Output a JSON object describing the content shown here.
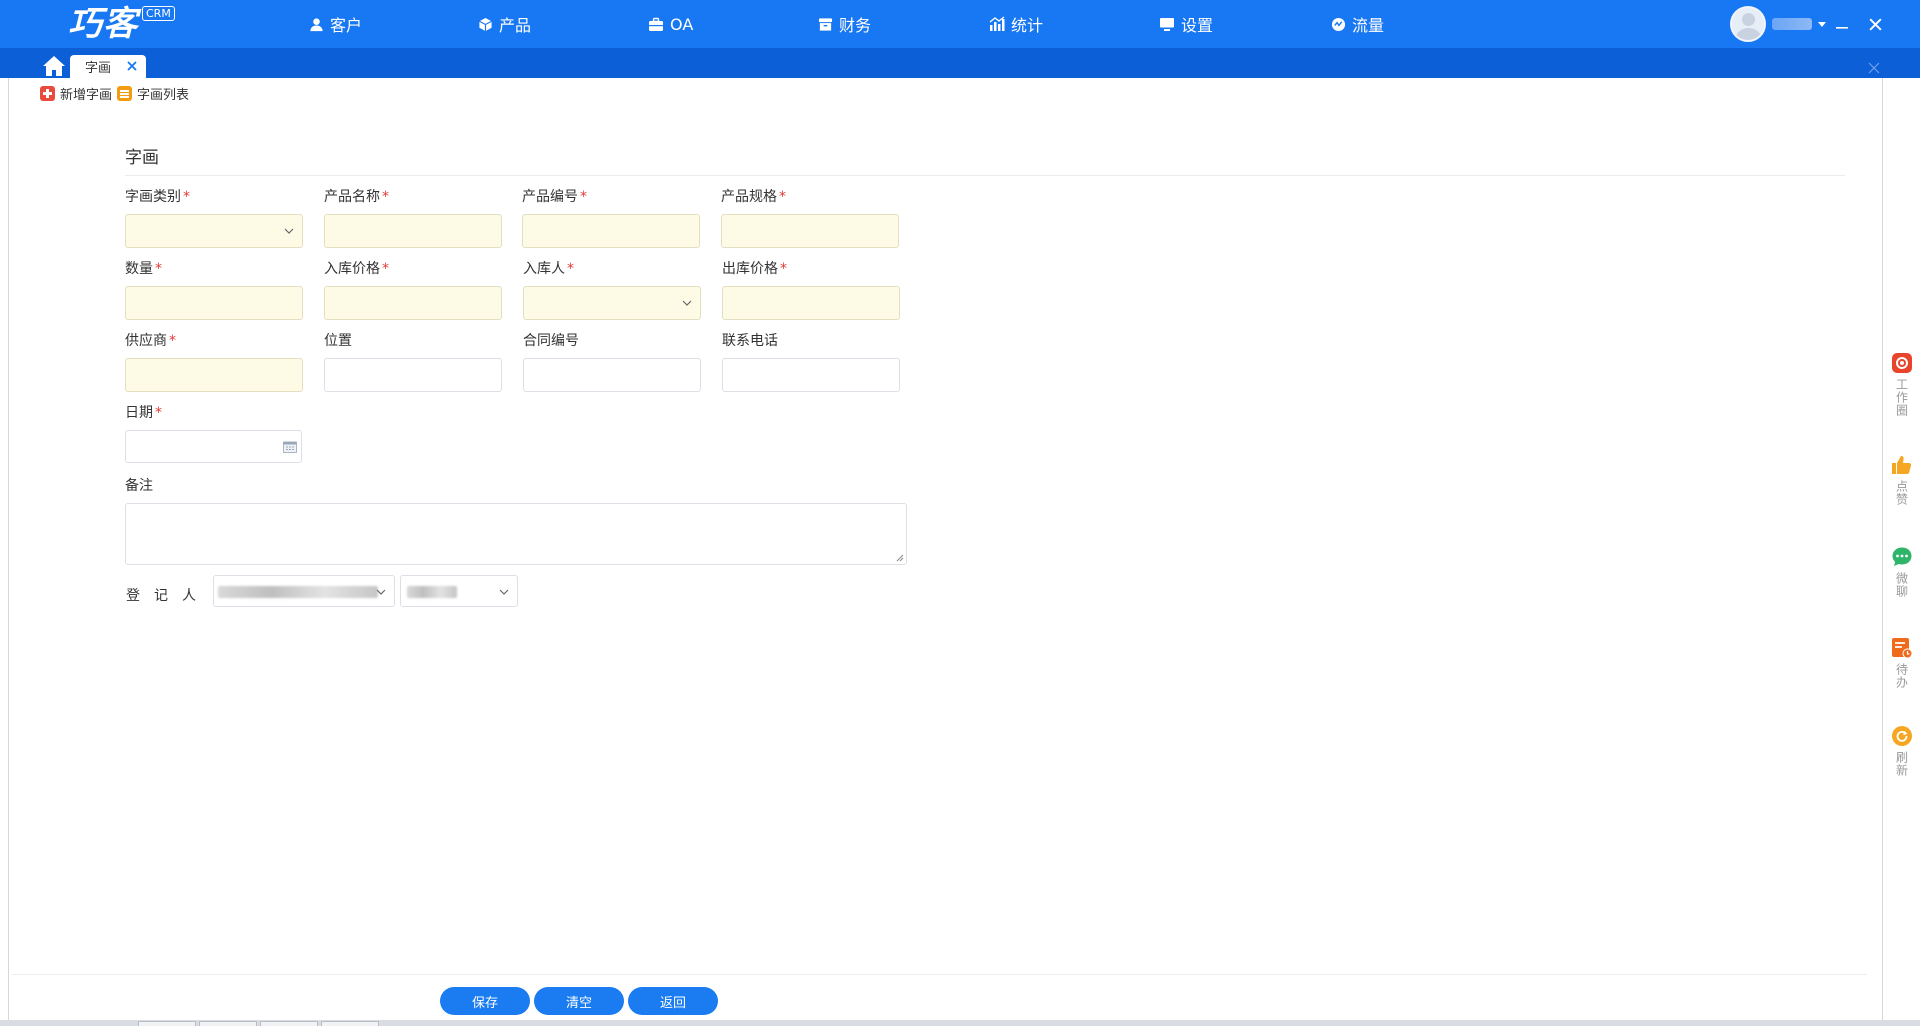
{
  "app": {
    "logo_text": "巧客",
    "logo_badge": "CRM"
  },
  "nav": {
    "items": [
      {
        "label": "客户",
        "icon": "user-icon"
      },
      {
        "label": "产品",
        "icon": "cube-icon"
      },
      {
        "label": "OA",
        "icon": "briefcase-icon"
      },
      {
        "label": "财务",
        "icon": "archive-icon"
      },
      {
        "label": "统计",
        "icon": "bar-chart-icon"
      },
      {
        "label": "设置",
        "icon": "monitor-icon"
      },
      {
        "label": "流量",
        "icon": "gauge-icon"
      }
    ]
  },
  "tabs": {
    "active_label": "字画"
  },
  "toolbar": {
    "add_label": "新增字画",
    "list_label": "字画列表"
  },
  "form": {
    "title": "字画",
    "fields": {
      "category": {
        "label": "字画类别",
        "required": "*"
      },
      "product_name": {
        "label": "产品名称",
        "required": "*"
      },
      "product_code": {
        "label": "产品编号",
        "required": "*"
      },
      "product_spec": {
        "label": "产品规格",
        "required": "*"
      },
      "quantity": {
        "label": "数量",
        "required": "*"
      },
      "in_price": {
        "label": "入库价格",
        "required": "*"
      },
      "in_person": {
        "label": "入库人",
        "required": "*"
      },
      "out_price": {
        "label": "出库价格",
        "required": "*"
      },
      "supplier": {
        "label": "供应商",
        "required": "*"
      },
      "location": {
        "label": "位置"
      },
      "contract_no": {
        "label": "合同编号"
      },
      "phone": {
        "label": "联系电话"
      },
      "date": {
        "label": "日期",
        "required": "*"
      },
      "remark": {
        "label": "备注"
      },
      "registrar": {
        "label": "登记人"
      }
    }
  },
  "sidebar": {
    "items": [
      {
        "label": "工作圈",
        "icon": "camera-icon",
        "color": "#e8452c"
      },
      {
        "label": "点赞",
        "icon": "thumbs-up-icon",
        "color": "#f5a623"
      },
      {
        "label": "微聊",
        "icon": "chat-icon",
        "color": "#2fb56a"
      },
      {
        "label": "待办",
        "icon": "todo-icon",
        "color": "#f06a1c"
      },
      {
        "label": "刷新",
        "icon": "refresh-icon",
        "color": "#f5a623"
      }
    ]
  },
  "actions": {
    "save_label": "保存",
    "clear_label": "清空",
    "back_label": "返回"
  },
  "colors": {
    "primary": "#1877f2",
    "tabbar": "#0d5fd8",
    "required_field_bg": "#fdfbe6",
    "required_mark": "#e53935",
    "button": "#1a7cf0"
  }
}
